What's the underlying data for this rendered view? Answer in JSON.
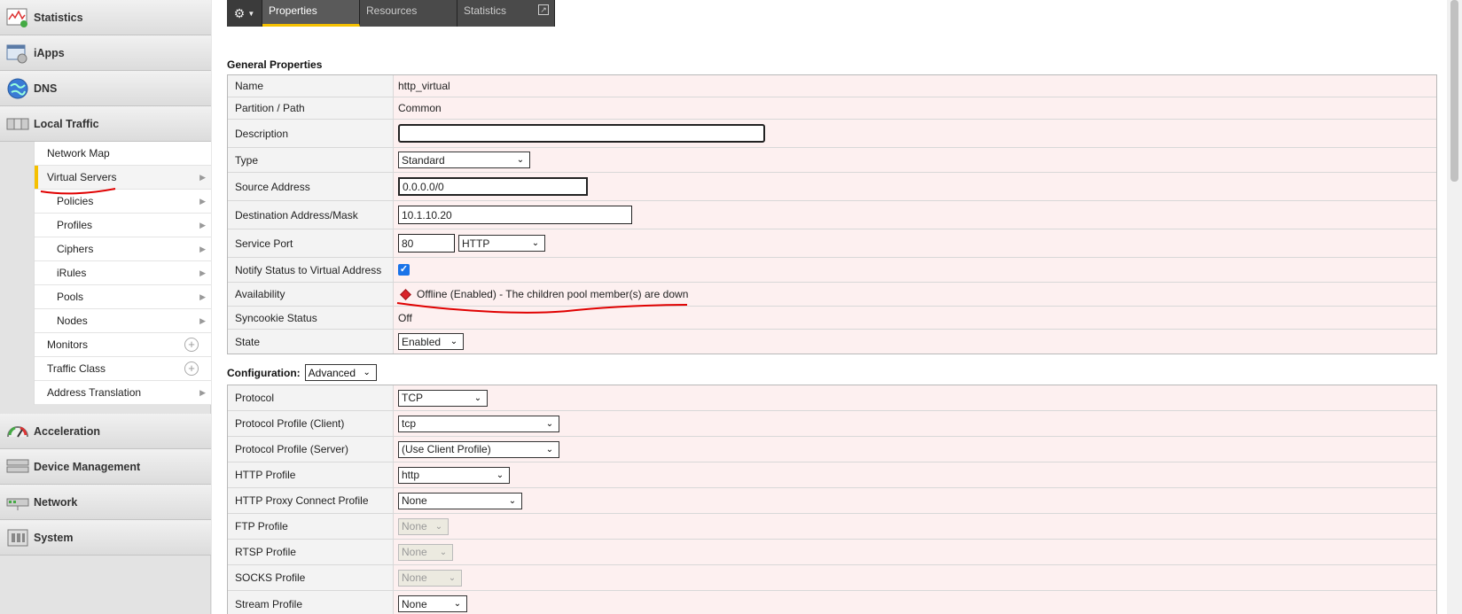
{
  "sidebar": {
    "main_items": [
      {
        "label": "Statistics",
        "icon": "statistics-icon"
      },
      {
        "label": "iApps",
        "icon": "iapps-icon"
      },
      {
        "label": "DNS",
        "icon": "globe-icon"
      },
      {
        "label": "Local Traffic",
        "icon": "local-traffic-icon"
      },
      {
        "label": "Acceleration",
        "icon": "gauge-icon"
      },
      {
        "label": "Device Management",
        "icon": "server-icon"
      },
      {
        "label": "Network",
        "icon": "network-icon"
      },
      {
        "label": "System",
        "icon": "system-icon"
      }
    ],
    "local_traffic_items": [
      {
        "label": "Network Map"
      },
      {
        "label": "Virtual Servers"
      },
      {
        "label": "Policies"
      },
      {
        "label": "Profiles"
      },
      {
        "label": "Ciphers"
      },
      {
        "label": "iRules"
      },
      {
        "label": "Pools"
      },
      {
        "label": "Nodes"
      },
      {
        "label": "Monitors"
      },
      {
        "label": "Traffic Class"
      },
      {
        "label": "Address Translation"
      }
    ]
  },
  "tabs": {
    "items": [
      "Properties",
      "Resources",
      "Statistics"
    ],
    "active": "Properties"
  },
  "general": {
    "title": "General Properties",
    "rows": {
      "name": {
        "label": "Name",
        "value": "http_virtual"
      },
      "partition": {
        "label": "Partition / Path",
        "value": "Common"
      },
      "description": {
        "label": "Description",
        "value": ""
      },
      "type": {
        "label": "Type",
        "value": "Standard"
      },
      "source": {
        "label": "Source Address",
        "value": "0.0.0.0/0"
      },
      "destination": {
        "label": "Destination Address/Mask",
        "value": "10.1.10.20"
      },
      "service_port": {
        "label": "Service Port",
        "port": "80",
        "protocol": "HTTP"
      },
      "notify": {
        "label": "Notify Status to Virtual Address",
        "checked": true
      },
      "availability": {
        "label": "Availability",
        "value": "Offline (Enabled) - The children pool member(s) are down",
        "status_color": "#d9232a"
      },
      "syncookie": {
        "label": "Syncookie Status",
        "value": "Off"
      },
      "state": {
        "label": "State",
        "value": "Enabled"
      }
    }
  },
  "configuration": {
    "title": "Configuration:",
    "mode": "Advanced",
    "rows": {
      "protocol": {
        "label": "Protocol",
        "value": "TCP"
      },
      "pp_client": {
        "label": "Protocol Profile (Client)",
        "value": "tcp"
      },
      "pp_server": {
        "label": "Protocol Profile (Server)",
        "value": "(Use Client Profile)"
      },
      "http_profile": {
        "label": "HTTP Profile",
        "value": "http"
      },
      "http_proxy": {
        "label": "HTTP Proxy Connect Profile",
        "value": "None"
      },
      "ftp": {
        "label": "FTP Profile",
        "value": "None"
      },
      "rtsp": {
        "label": "RTSP Profile",
        "value": "None"
      },
      "socks": {
        "label": "SOCKS Profile",
        "value": "None"
      },
      "stream": {
        "label": "Stream Profile",
        "value": "None"
      }
    }
  },
  "colors": {
    "accent": "#f5c000",
    "annotation": "#e00000",
    "row_bg": "#fdf0f0"
  }
}
